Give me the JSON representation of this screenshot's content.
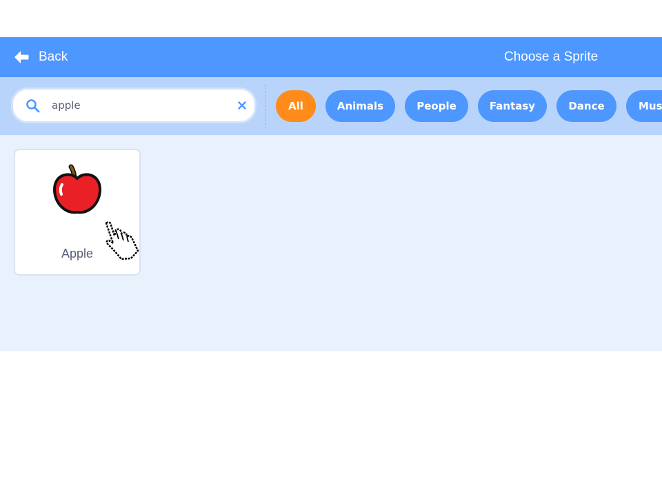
{
  "header": {
    "back_label": "Back",
    "back_icon": "arrow-left-icon",
    "title": "Choose a Sprite",
    "background": "#4d97ff"
  },
  "search": {
    "value": "apple",
    "search_icon": "search-icon",
    "clear_icon": "close-icon"
  },
  "filters": {
    "tags": [
      {
        "label": "All",
        "active": true
      },
      {
        "label": "Animals",
        "active": false
      },
      {
        "label": "People",
        "active": false
      },
      {
        "label": "Fantasy",
        "active": false
      },
      {
        "label": "Dance",
        "active": false
      },
      {
        "label": "Mus",
        "active": false
      }
    ],
    "active_color": "#ff8c1a",
    "tag_color": "#4d97ff"
  },
  "results": [
    {
      "name": "Apple",
      "icon": "apple-icon"
    }
  ],
  "cursor": {
    "icon": "hand-pointer-cursor-icon"
  }
}
